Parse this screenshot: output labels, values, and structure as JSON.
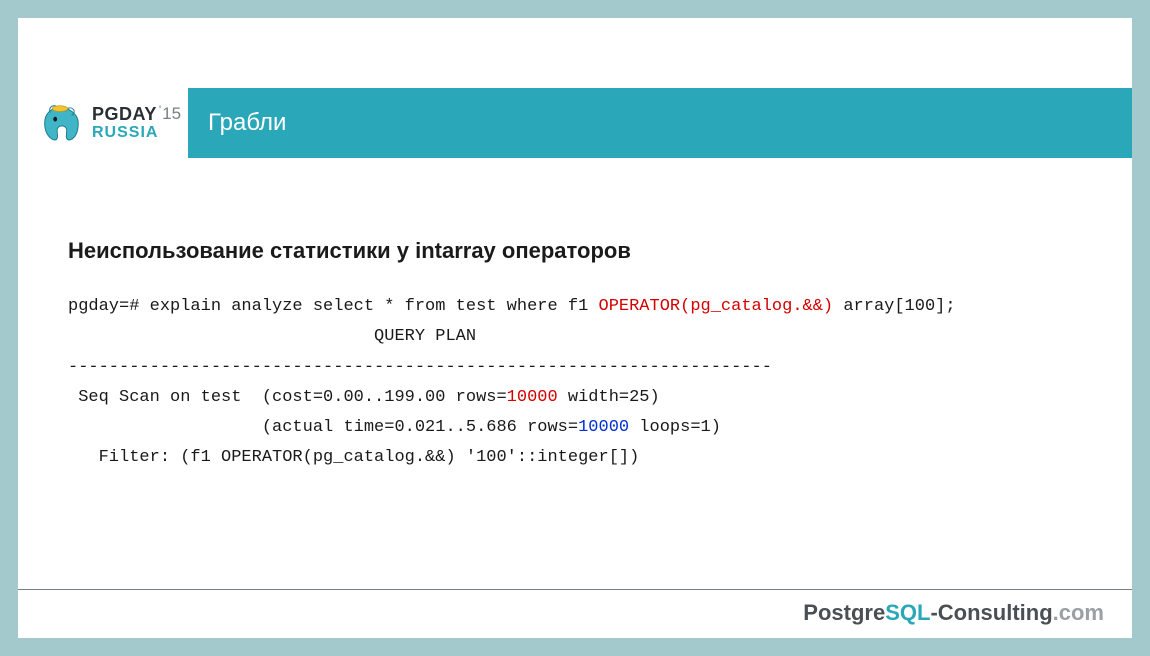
{
  "logo": {
    "line1": "PGDAY",
    "apostrophe": "'",
    "year": "15",
    "line2": "RUSSIA"
  },
  "title": "Грабли",
  "subhead": "Неиспользование статистики у intarray операторов",
  "code": {
    "l1a": "pgday=# explain analyze select * from test where f1 ",
    "l1b": "OPERATOR(pg_catalog.&&)",
    "l1c": " array[100];",
    "l2": "                              QUERY PLAN",
    "l3": "---------------------------------------------------------------------",
    "l4a": " Seq Scan on test  (cost=0.00..199.00 rows=",
    "l4b": "10000",
    "l4c": " width=25)",
    "l5a": "                   (actual time=0.021..5.686 rows=",
    "l5b": "10000",
    "l5c": " loops=1)",
    "l6": "   Filter: (f1 OPERATOR(pg_catalog.&&) '100'::integer[])"
  },
  "footer": {
    "p1": "Postgre",
    "p2": "SQL",
    "p3": "-Consulting",
    "p4": ".com"
  }
}
